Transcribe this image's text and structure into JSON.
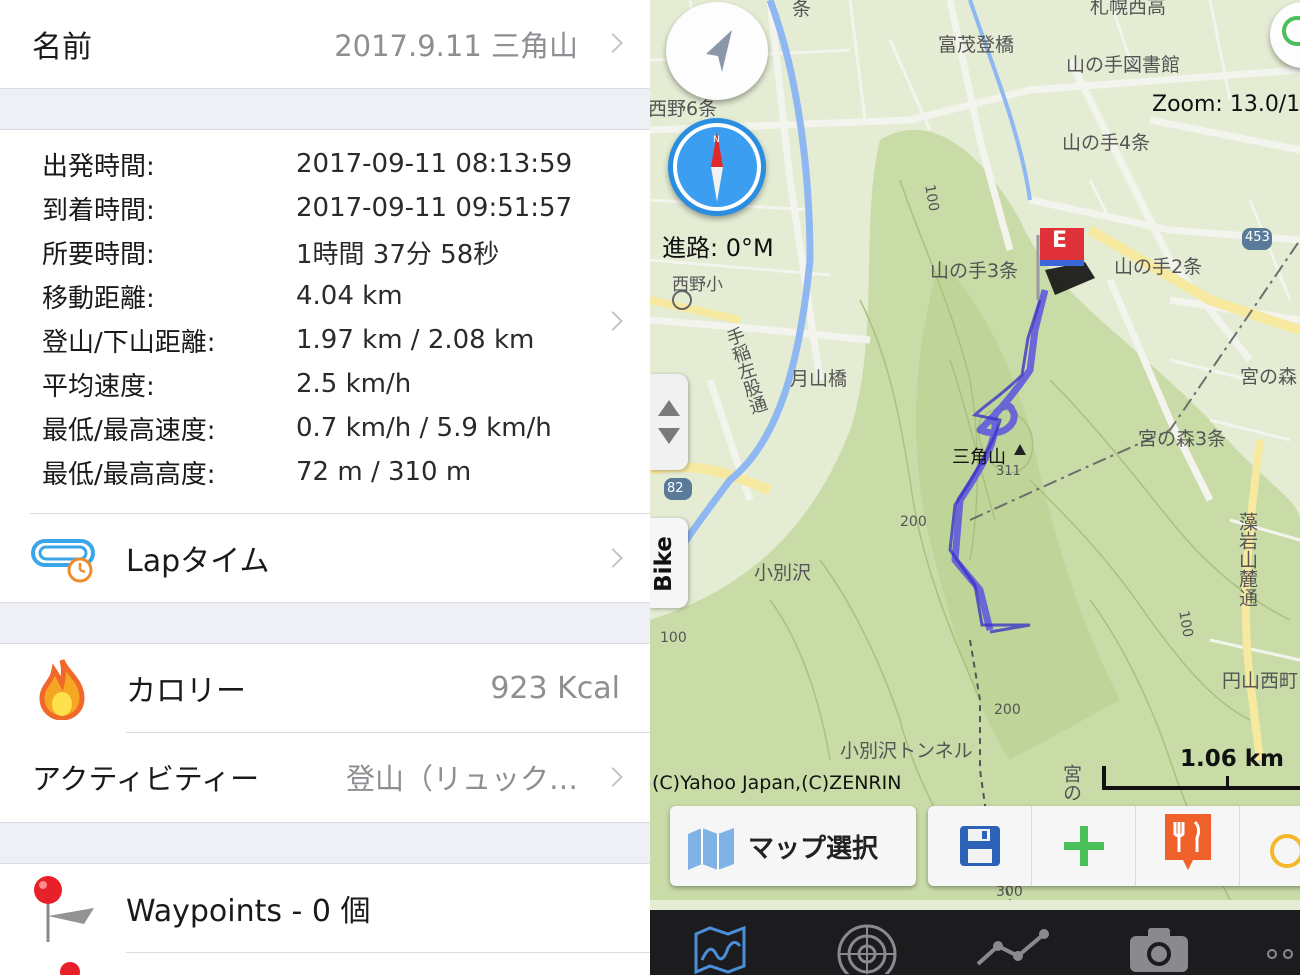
{
  "left": {
    "name_label": "名前",
    "name_value": "2017.9.11 三角山",
    "stats": [
      {
        "label": "出発時間:",
        "value": "2017-09-11 08:13:59"
      },
      {
        "label": "到着時間:",
        "value": "2017-09-11 09:51:57"
      },
      {
        "label": "所要時間:",
        "value": "1時間 37分 58秒"
      },
      {
        "label": "移動距離:",
        "value": "4.04 km"
      },
      {
        "label": "登山/下山距離:",
        "value": "1.97 km / 2.08 km"
      },
      {
        "label": "平均速度:",
        "value": "2.5 km/h"
      },
      {
        "label": "最低/最高速度:",
        "value": "0.7 km/h / 5.9 km/h"
      },
      {
        "label": "最低/最高高度:",
        "value": "72 m / 310 m"
      }
    ],
    "lap_label": "Lapタイム",
    "calorie_label": "カロリー",
    "calorie_value": "923 Kcal",
    "activity_label": "アクティビティー",
    "activity_value": "登山（リュック…",
    "waypoints_label": "Waypoints - 0 個"
  },
  "map": {
    "zoom_text": "Zoom: 13.0/1",
    "heading_text": "進路: 0°M",
    "copyright": "(C)Yahoo Japan,(C)ZENRIN",
    "scale_text": "1.06 km",
    "bike_label": "Bike",
    "map_select_label": "マップ選択",
    "end_flag_letter": "E",
    "route_color": "#5a52e0",
    "labels": {
      "tomimo": "富茂登橋",
      "sapporo_nishi": "札幌西高",
      "yamanote_lib": "山の手図書館",
      "nishino6": "西野6条",
      "yamanote4": "山の手4条",
      "yamanote3": "山の手3条",
      "yamanote2": "山の手2条",
      "nishino_sho": "西野小",
      "teine_sagan": "手稲左股通",
      "gassan": "月山橋",
      "sankakuyama": "三角山",
      "peak_311": "311",
      "miyanomori": "宮の森",
      "miyanomori3": "宮の森3条",
      "kobetsusawa": "小別沢",
      "kobetsu_tunnel": "小別沢トンネル",
      "moiwa": "藻岩山麓通",
      "maruyama_nishi": "円山西町",
      "miya_edge": "宮の",
      "route_453": "453",
      "route_82": "82",
      "c100a": "100",
      "c100b": "100",
      "c100c": "100",
      "c200a": "200",
      "c200b": "200",
      "c300": "300",
      "jo": "条"
    }
  }
}
